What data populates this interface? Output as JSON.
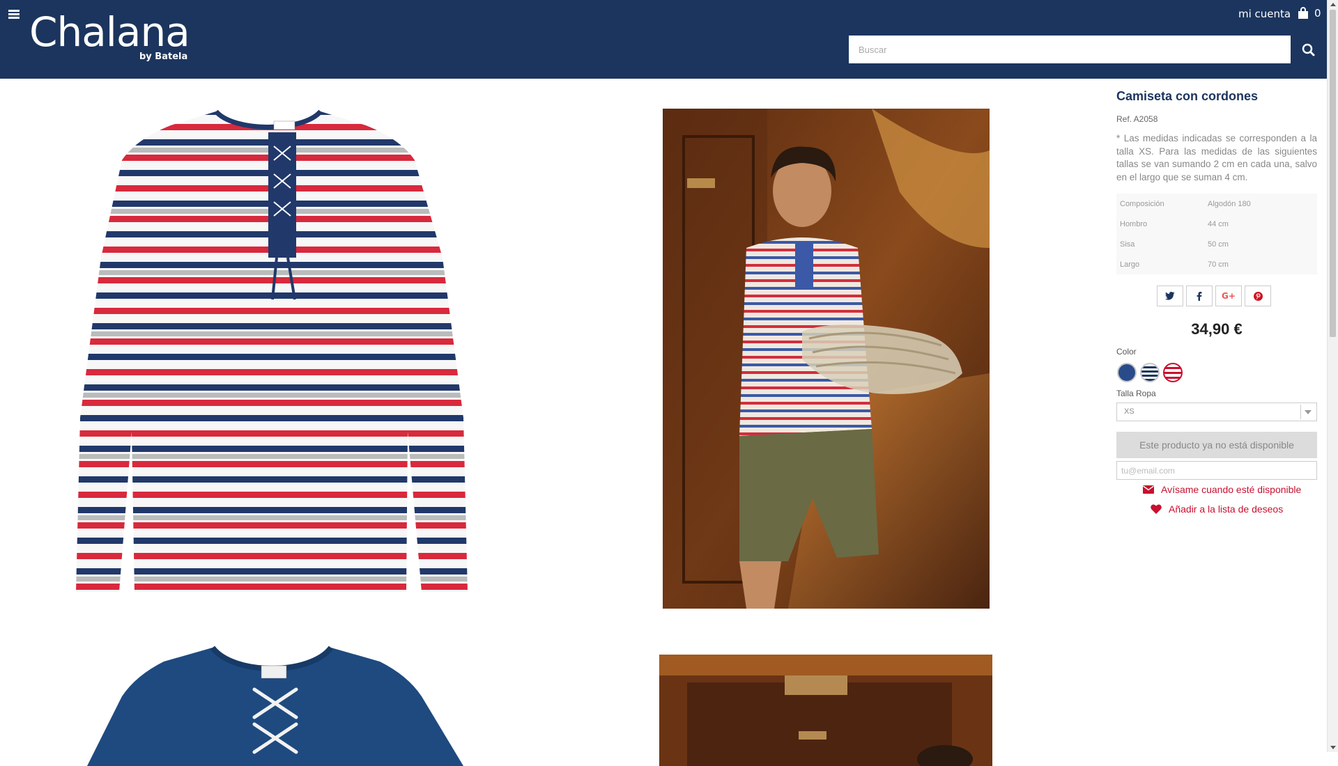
{
  "header": {
    "logo_main": "Chalana",
    "logo_sub": "by Batela",
    "account_label": "mi cuenta",
    "cart_count": "0",
    "search_placeholder": "Buscar"
  },
  "product": {
    "title": "Camiseta con cordones",
    "ref": "Ref. A2058",
    "description": "* Las medidas indicadas se corresponden a la talla XS. Para las medidas de las siguientes tallas se van sumando 2 cm en cada una, salvo en el largo que se suman 4 cm.",
    "specs": [
      {
        "label": "Composición",
        "value": "Algodón 180"
      },
      {
        "label": "Hombro",
        "value": "44 cm"
      },
      {
        "label": "Sisa",
        "value": "50 cm"
      },
      {
        "label": "Largo",
        "value": "70 cm"
      }
    ],
    "share_icons": [
      "twitter-icon",
      "facebook-icon",
      "google-plus-icon",
      "pinterest-icon"
    ],
    "price": "34,90 €",
    "color_label": "Color",
    "colors": [
      {
        "name": "navy",
        "hex": "#2a4b8a"
      },
      {
        "name": "navy-stripe",
        "hex": "#1c355e"
      },
      {
        "name": "red-stripe",
        "hex": "#c8102e"
      }
    ],
    "size_label": "Talla Ropa",
    "size_selected": "XS",
    "unavailable_label": "Este producto ya no está disponible",
    "email_placeholder": "tu@email.com",
    "notify_label": "Avísame cuando esté disponible",
    "wishlist_label": "Añadir a la lista de deseos"
  },
  "colors": {
    "header_bg": "#1c355e",
    "accent_red": "#c8102e",
    "title_blue": "#1c355e"
  }
}
